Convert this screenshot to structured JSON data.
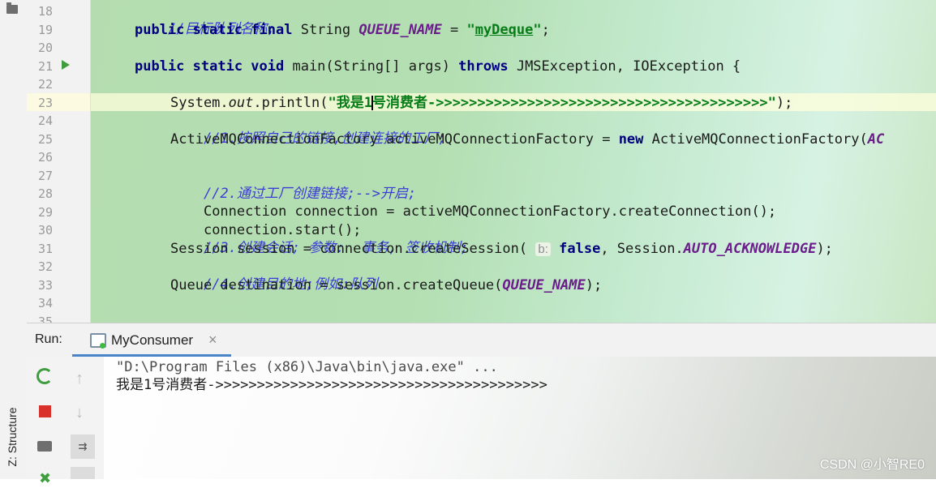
{
  "editor": {
    "line_numbers": [
      "18",
      "19",
      "20",
      "21",
      "22",
      "23",
      "24",
      "25",
      "26",
      "27",
      "28",
      "29",
      "30",
      "31",
      "32",
      "33",
      "34",
      "35"
    ],
    "lines": {
      "l18": "//目标队列名称;",
      "l19_kw": "public static final",
      "l19_type": " String ",
      "l19_const": "QUEUE_NAME",
      "l19_eq": " = ",
      "l19_q1": "\"",
      "l19_str": "myDeque",
      "l19_q2": "\"",
      "l19_end": ";",
      "l21_kw": "public static void",
      "l21_mid": " main(String[] args) ",
      "l21_throws": "throws",
      "l21_end": " JMSException, IOException {",
      "l23_a": "System.",
      "l23_out": "out",
      "l23_b": ".println(",
      "l23_str1": "\"我是1",
      "l23_str2": "号消费者->>>>>>>>>>>>>>>>>>>>>>>>>>>>>>>>>>>>>>>>\"",
      "l23_end": ");",
      "l24": "//1.按照自己的链接,创建连接的工厂;",
      "l25_a": "ActiveMQConnectionFactory activeMQConnectionFactory = ",
      "l25_new": "new",
      "l25_b": " ActiveMQConnectionFactory(",
      "l25_c": "AC",
      "l27": "//2.通过工厂创建链接;-->开启;",
      "l28": "Connection connection = activeMQConnectionFactory.createConnection();",
      "l29": "connection.start();",
      "l30": "//3.创建会话; 参数:  事务, 签收机制;",
      "l31_a": "Session session = connection.createSession(",
      "l31_hint": "b:",
      "l31_false": "false",
      "l31_b": ", Session.",
      "l31_const": "AUTO_ACKNOWLEDGE",
      "l31_end": ");",
      "l32": "//4.创建目的地;例如:队列",
      "l33_a": "Queue destination = session.createQueue(",
      "l33_const": "QUEUE_NAME",
      "l33_end": ");"
    }
  },
  "run_panel": {
    "label": "Run:",
    "tab_label": "MyConsumer",
    "tab_close": "×",
    "console": [
      "\"D:\\Program Files (x86)\\Java\\bin\\java.exe\" ...",
      "我是1号消费者->>>>>>>>>>>>>>>>>>>>>>>>>>>>>>>>>>>>>>>>"
    ]
  },
  "side_tab": {
    "label": "Z: Structure"
  },
  "watermark": "CSDN @小智RE0",
  "icons": {
    "rerun": "rerun-icon",
    "stop": "stop-icon",
    "camera": "camera-icon",
    "up": "↑",
    "down": "↓",
    "wrap": "⇉"
  }
}
